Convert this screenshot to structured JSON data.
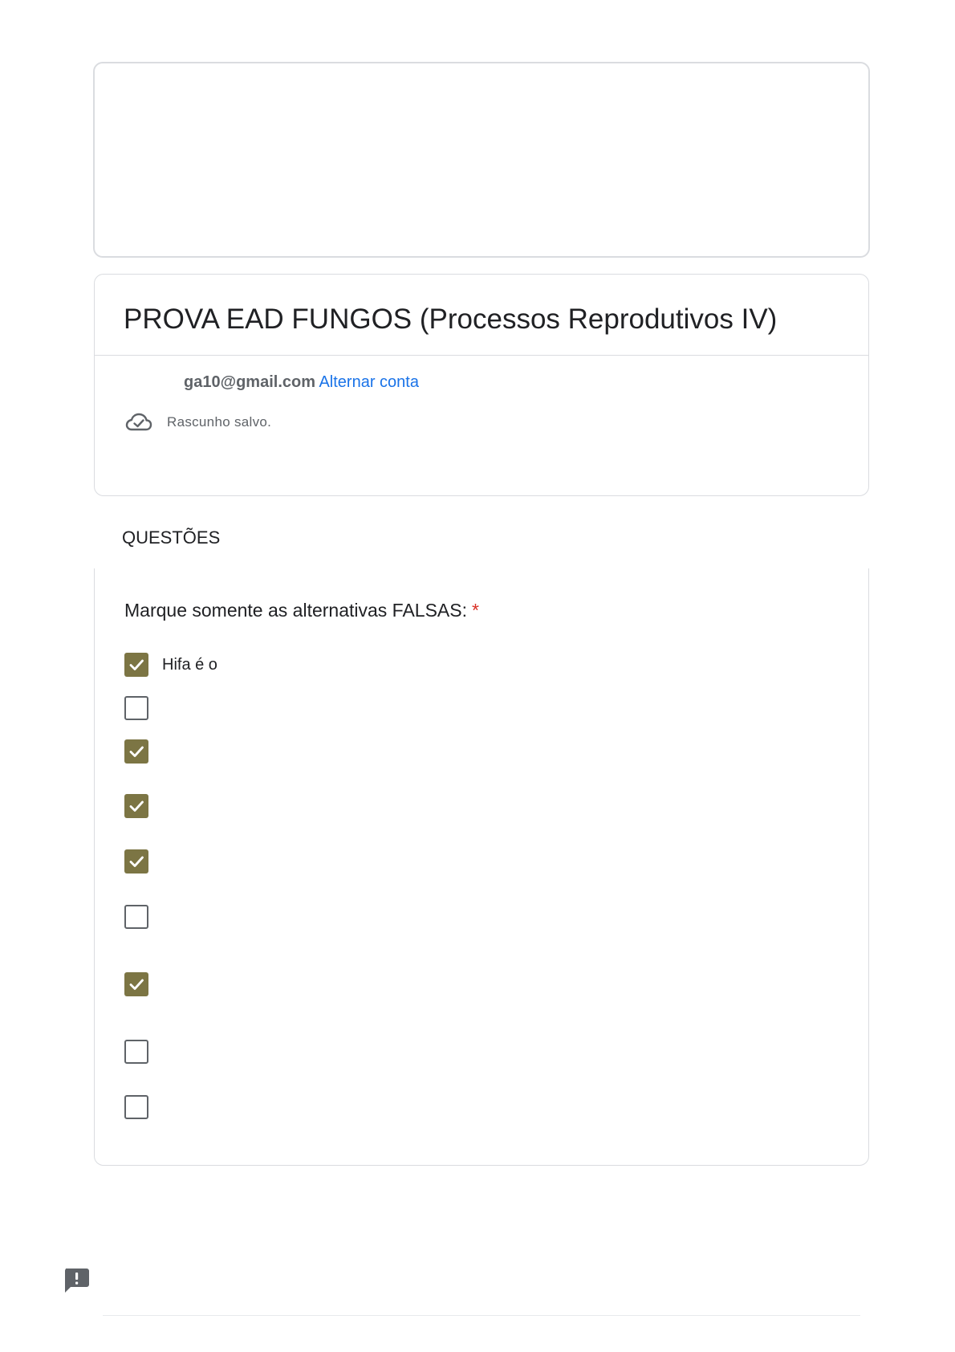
{
  "form": {
    "title": "PROVA EAD FUNGOS (Processos Reprodutivos IV)",
    "account": {
      "email": "ga10@gmail.com",
      "switch_label": "Alternar conta"
    },
    "save_status": "Rascunho salvo.",
    "section_title": "QUESTÕES"
  },
  "question": {
    "title": "Marque somente as alternativas FALSAS:",
    "required_marker": "*",
    "options": [
      {
        "label": "Hifa é o",
        "checked": true
      },
      {
        "label": "",
        "checked": false
      },
      {
        "label": "",
        "checked": true
      },
      {
        "label": "",
        "checked": true
      },
      {
        "label": "",
        "checked": true
      },
      {
        "label": "",
        "checked": false
      },
      {
        "label": "",
        "checked": true
      },
      {
        "label": "",
        "checked": false
      },
      {
        "label": "",
        "checked": false
      }
    ]
  },
  "colors": {
    "checkbox_checked": "#7c7544",
    "link": "#1a73e8",
    "required": "#d93025"
  },
  "icons": {
    "save_status": "cloud-done-icon",
    "feedback": "report-problem-icon"
  }
}
